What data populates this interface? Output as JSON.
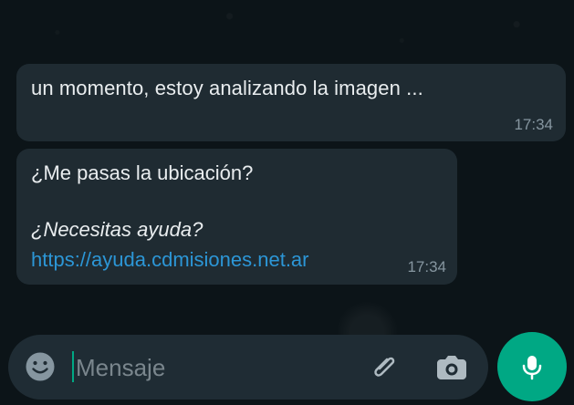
{
  "messages": [
    {
      "text": "un momento, estoy analizando la imagen ...",
      "time": "17:34"
    },
    {
      "question": "¿Me pasas la ubicación?",
      "help": "¿Necesitas ayuda?",
      "link": "https://ayuda.cdmisiones.net.ar",
      "time": "17:34"
    }
  ],
  "composer": {
    "placeholder": "Mensaje"
  },
  "colors": {
    "accent": "#00a884",
    "bubble": "#1f2b32",
    "link": "#2c96d6",
    "time": "#8696a0"
  },
  "icons": {
    "emoji": "emoji-icon",
    "attach": "attach-icon",
    "camera": "camera-icon",
    "mic": "mic-icon"
  }
}
